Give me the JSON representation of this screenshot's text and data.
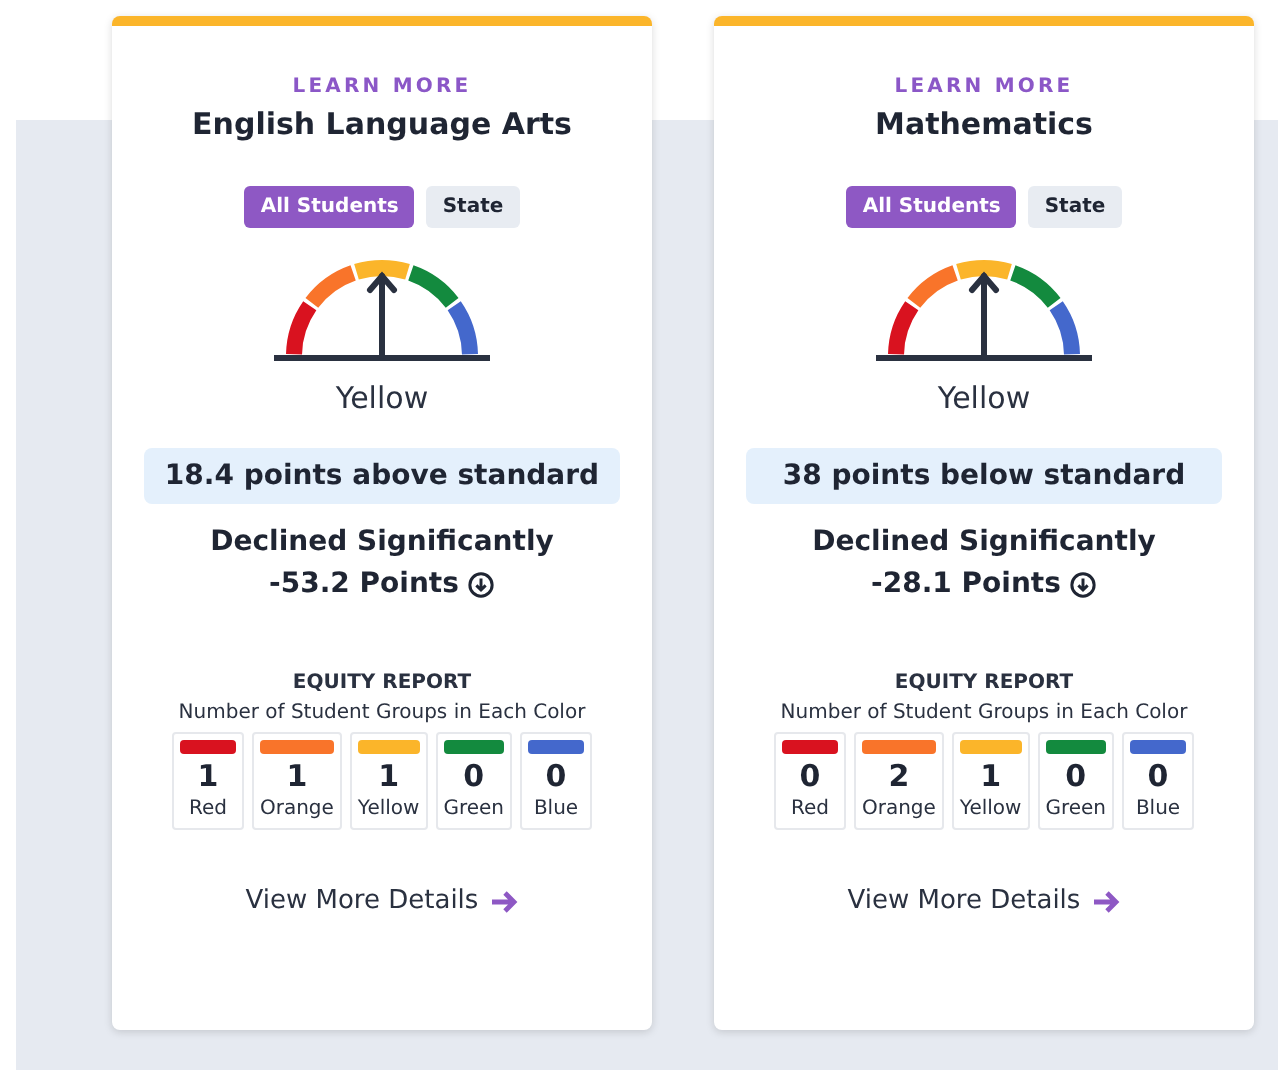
{
  "cards": [
    {
      "link": "LEARN MORE",
      "title": "English Language Arts",
      "toggles": [
        {
          "label": "All Students",
          "selected": true
        },
        {
          "label": "State",
          "selected": false
        }
      ],
      "rating": "Yellow",
      "distance": "18.4 points above standard",
      "change": "Declined Significantly",
      "change_points": "-53.2 Points",
      "equity": {
        "title": "EQUITY REPORT",
        "subtitle": "Number of Student Groups in Each Color",
        "groups": [
          {
            "count": "1",
            "label": "Red",
            "color": "#d9121f"
          },
          {
            "count": "1",
            "label": "Orange",
            "color": "#f9742a"
          },
          {
            "count": "1",
            "label": "Yellow",
            "color": "#fbb52a"
          },
          {
            "count": "0",
            "label": "Green",
            "color": "#138a3e"
          },
          {
            "count": "0",
            "label": "Blue",
            "color": "#4468cc"
          }
        ]
      },
      "details": "View More Details"
    },
    {
      "link": "LEARN MORE",
      "title": "Mathematics",
      "toggles": [
        {
          "label": "All Students",
          "selected": true
        },
        {
          "label": "State",
          "selected": false
        }
      ],
      "rating": "Yellow",
      "distance": "38 points below standard",
      "change": "Declined Significantly",
      "change_points": "-28.1 Points",
      "equity": {
        "title": "EQUITY REPORT",
        "subtitle": "Number of Student Groups in Each Color",
        "groups": [
          {
            "count": "0",
            "label": "Red",
            "color": "#d9121f"
          },
          {
            "count": "2",
            "label": "Orange",
            "color": "#f9742a"
          },
          {
            "count": "1",
            "label": "Yellow",
            "color": "#fbb52a"
          },
          {
            "count": "0",
            "label": "Green",
            "color": "#138a3e"
          },
          {
            "count": "0",
            "label": "Blue",
            "color": "#4468cc"
          }
        ]
      },
      "details": "View More Details"
    }
  ]
}
